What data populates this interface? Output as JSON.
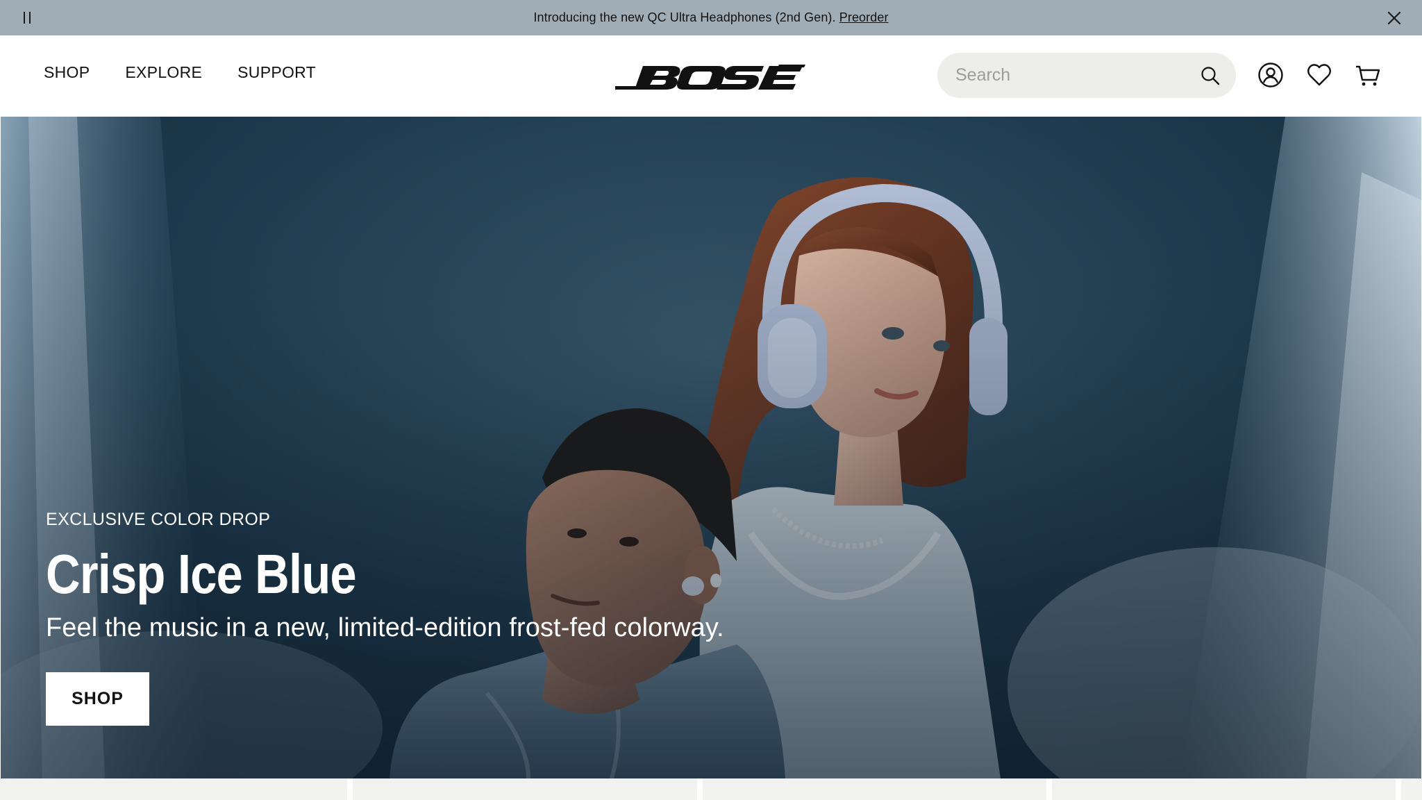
{
  "announcement": {
    "text": "Introducing the new QC Ultra Headphones (2nd Gen).",
    "link_label": "Preorder",
    "pause_icon": "pause-icon",
    "close_icon": "close-icon"
  },
  "header": {
    "nav": [
      {
        "label": "SHOP"
      },
      {
        "label": "EXPLORE"
      },
      {
        "label": "SUPPORT"
      }
    ],
    "logo_alt": "BOSE",
    "search": {
      "placeholder": "Search",
      "value": "",
      "icon": "search-icon"
    },
    "icons": [
      "account-icon",
      "wishlist-heart-icon",
      "cart-icon"
    ]
  },
  "hero": {
    "eyebrow": "EXCLUSIVE COLOR DROP",
    "title": "Crisp Ice Blue",
    "subtitle": "Feel the music in a new, limited-edition frost-fed colorway.",
    "cta_label": "SHOP"
  },
  "colors": {
    "announcement_bg": "#a0acb6",
    "search_bg": "#ededea",
    "hero_bg": "#1f3a4e",
    "text_dark": "#111111",
    "text_light": "#ffffff"
  }
}
